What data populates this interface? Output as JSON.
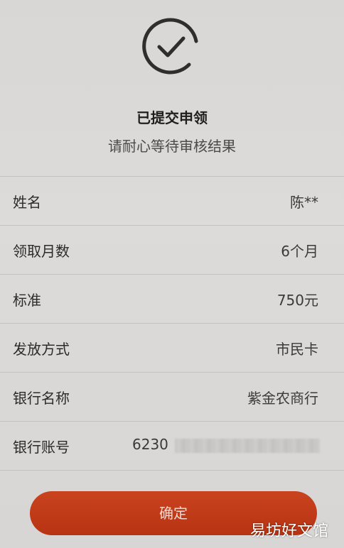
{
  "header": {
    "title": "已提交申领",
    "subtitle": "请耐心等待审核结果"
  },
  "details": [
    {
      "label": "姓名",
      "value": "陈**"
    },
    {
      "label": "领取月数",
      "value": "6个月"
    },
    {
      "label": "标准",
      "value": "750元"
    },
    {
      "label": "发放方式",
      "value": "市民卡"
    },
    {
      "label": "银行名称",
      "value": "紫金农商行"
    },
    {
      "label": "银行账号",
      "value": "6230"
    }
  ],
  "actions": {
    "confirm_label": "确定"
  },
  "watermark": "易坊好文馆",
  "colors": {
    "accent": "#c03a17",
    "icon": "#2e2e2e",
    "background": "#dcdad8"
  },
  "icons": {
    "status": "check-circle-icon"
  }
}
